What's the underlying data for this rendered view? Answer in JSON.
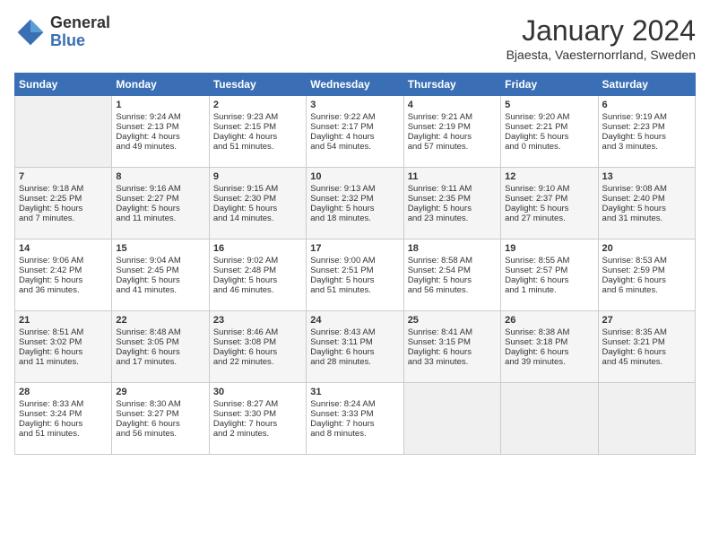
{
  "header": {
    "logo_line1": "General",
    "logo_line2": "Blue",
    "title": "January 2024",
    "subtitle": "Bjaesta, Vaesternorrland, Sweden"
  },
  "days_of_week": [
    "Sunday",
    "Monday",
    "Tuesday",
    "Wednesday",
    "Thursday",
    "Friday",
    "Saturday"
  ],
  "weeks": [
    [
      {
        "day": "",
        "content": ""
      },
      {
        "day": "1",
        "content": "Sunrise: 9:24 AM\nSunset: 2:13 PM\nDaylight: 4 hours\nand 49 minutes."
      },
      {
        "day": "2",
        "content": "Sunrise: 9:23 AM\nSunset: 2:15 PM\nDaylight: 4 hours\nand 51 minutes."
      },
      {
        "day": "3",
        "content": "Sunrise: 9:22 AM\nSunset: 2:17 PM\nDaylight: 4 hours\nand 54 minutes."
      },
      {
        "day": "4",
        "content": "Sunrise: 9:21 AM\nSunset: 2:19 PM\nDaylight: 4 hours\nand 57 minutes."
      },
      {
        "day": "5",
        "content": "Sunrise: 9:20 AM\nSunset: 2:21 PM\nDaylight: 5 hours\nand 0 minutes."
      },
      {
        "day": "6",
        "content": "Sunrise: 9:19 AM\nSunset: 2:23 PM\nDaylight: 5 hours\nand 3 minutes."
      }
    ],
    [
      {
        "day": "7",
        "content": "Sunrise: 9:18 AM\nSunset: 2:25 PM\nDaylight: 5 hours\nand 7 minutes."
      },
      {
        "day": "8",
        "content": "Sunrise: 9:16 AM\nSunset: 2:27 PM\nDaylight: 5 hours\nand 11 minutes."
      },
      {
        "day": "9",
        "content": "Sunrise: 9:15 AM\nSunset: 2:30 PM\nDaylight: 5 hours\nand 14 minutes."
      },
      {
        "day": "10",
        "content": "Sunrise: 9:13 AM\nSunset: 2:32 PM\nDaylight: 5 hours\nand 18 minutes."
      },
      {
        "day": "11",
        "content": "Sunrise: 9:11 AM\nSunset: 2:35 PM\nDaylight: 5 hours\nand 23 minutes."
      },
      {
        "day": "12",
        "content": "Sunrise: 9:10 AM\nSunset: 2:37 PM\nDaylight: 5 hours\nand 27 minutes."
      },
      {
        "day": "13",
        "content": "Sunrise: 9:08 AM\nSunset: 2:40 PM\nDaylight: 5 hours\nand 31 minutes."
      }
    ],
    [
      {
        "day": "14",
        "content": "Sunrise: 9:06 AM\nSunset: 2:42 PM\nDaylight: 5 hours\nand 36 minutes."
      },
      {
        "day": "15",
        "content": "Sunrise: 9:04 AM\nSunset: 2:45 PM\nDaylight: 5 hours\nand 41 minutes."
      },
      {
        "day": "16",
        "content": "Sunrise: 9:02 AM\nSunset: 2:48 PM\nDaylight: 5 hours\nand 46 minutes."
      },
      {
        "day": "17",
        "content": "Sunrise: 9:00 AM\nSunset: 2:51 PM\nDaylight: 5 hours\nand 51 minutes."
      },
      {
        "day": "18",
        "content": "Sunrise: 8:58 AM\nSunset: 2:54 PM\nDaylight: 5 hours\nand 56 minutes."
      },
      {
        "day": "19",
        "content": "Sunrise: 8:55 AM\nSunset: 2:57 PM\nDaylight: 6 hours\nand 1 minute."
      },
      {
        "day": "20",
        "content": "Sunrise: 8:53 AM\nSunset: 2:59 PM\nDaylight: 6 hours\nand 6 minutes."
      }
    ],
    [
      {
        "day": "21",
        "content": "Sunrise: 8:51 AM\nSunset: 3:02 PM\nDaylight: 6 hours\nand 11 minutes."
      },
      {
        "day": "22",
        "content": "Sunrise: 8:48 AM\nSunset: 3:05 PM\nDaylight: 6 hours\nand 17 minutes."
      },
      {
        "day": "23",
        "content": "Sunrise: 8:46 AM\nSunset: 3:08 PM\nDaylight: 6 hours\nand 22 minutes."
      },
      {
        "day": "24",
        "content": "Sunrise: 8:43 AM\nSunset: 3:11 PM\nDaylight: 6 hours\nand 28 minutes."
      },
      {
        "day": "25",
        "content": "Sunrise: 8:41 AM\nSunset: 3:15 PM\nDaylight: 6 hours\nand 33 minutes."
      },
      {
        "day": "26",
        "content": "Sunrise: 8:38 AM\nSunset: 3:18 PM\nDaylight: 6 hours\nand 39 minutes."
      },
      {
        "day": "27",
        "content": "Sunrise: 8:35 AM\nSunset: 3:21 PM\nDaylight: 6 hours\nand 45 minutes."
      }
    ],
    [
      {
        "day": "28",
        "content": "Sunrise: 8:33 AM\nSunset: 3:24 PM\nDaylight: 6 hours\nand 51 minutes."
      },
      {
        "day": "29",
        "content": "Sunrise: 8:30 AM\nSunset: 3:27 PM\nDaylight: 6 hours\nand 56 minutes."
      },
      {
        "day": "30",
        "content": "Sunrise: 8:27 AM\nSunset: 3:30 PM\nDaylight: 7 hours\nand 2 minutes."
      },
      {
        "day": "31",
        "content": "Sunrise: 8:24 AM\nSunset: 3:33 PM\nDaylight: 7 hours\nand 8 minutes."
      },
      {
        "day": "",
        "content": ""
      },
      {
        "day": "",
        "content": ""
      },
      {
        "day": "",
        "content": ""
      }
    ]
  ]
}
